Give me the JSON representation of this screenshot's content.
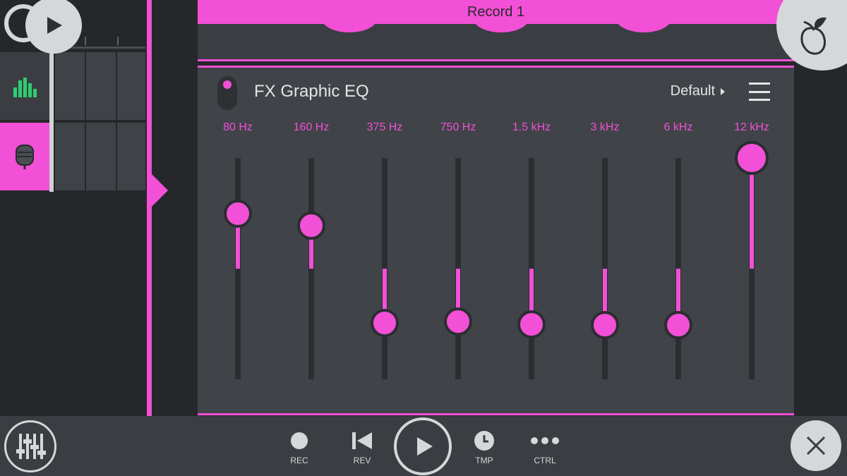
{
  "header": {
    "title": "Record 1"
  },
  "fx": {
    "title": "FX Graphic EQ",
    "preset": "Default",
    "enabled": true,
    "bands": [
      {
        "label": "80 Hz",
        "gain": 0.5
      },
      {
        "label": "160 Hz",
        "gain": 0.39
      },
      {
        "label": "375 Hz",
        "gain": -0.49
      },
      {
        "label": "750 Hz",
        "gain": -0.48
      },
      {
        "label": "1.5 kHz",
        "gain": -0.5
      },
      {
        "label": "3 kHz",
        "gain": -0.51
      },
      {
        "label": "6 kHz",
        "gain": -0.51
      },
      {
        "label": "12 kHz",
        "gain": 1.0
      }
    ]
  },
  "transport": {
    "rec": "REC",
    "rev": "REV",
    "tmp": "TMP",
    "ctrl": "CTRL"
  },
  "colors": {
    "accent": "#f250d6",
    "panel": "#404348",
    "background": "#25272a",
    "meter_green": "#2ecc71"
  },
  "icons": [
    "record-wheel-icon",
    "play-icon",
    "level-meter-icon",
    "microphone-icon",
    "fruit-logo-icon",
    "mixer-icon",
    "record-icon",
    "rewind-icon",
    "clock-icon",
    "more-dots-icon",
    "close-icon",
    "menu-icon"
  ]
}
